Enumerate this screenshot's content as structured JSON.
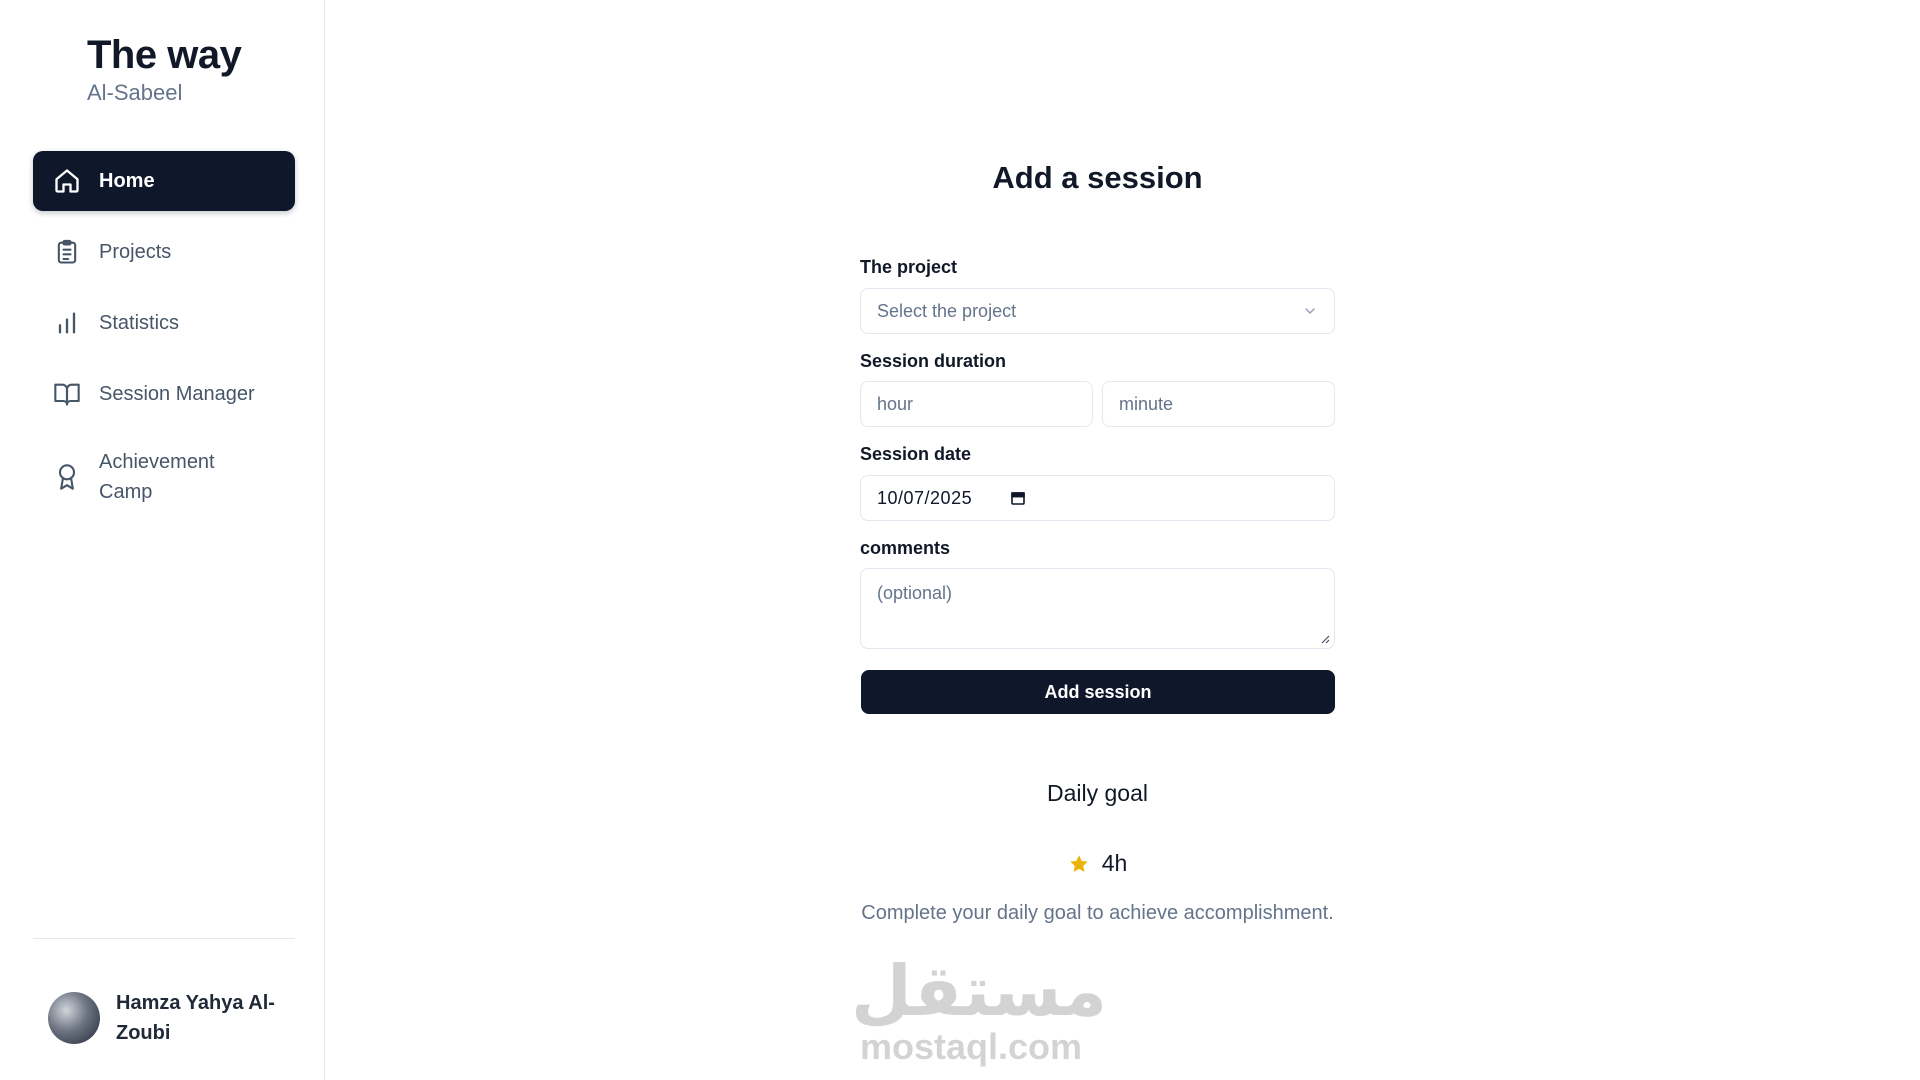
{
  "brand": {
    "title": "The way",
    "subtitle": "Al-Sabeel"
  },
  "nav": [
    {
      "label": "Home",
      "icon": "home-icon",
      "active": true
    },
    {
      "label": "Projects",
      "icon": "clipboard-icon",
      "active": false
    },
    {
      "label": "Statistics",
      "icon": "bar-chart-icon",
      "active": false
    },
    {
      "label": "Session Manager",
      "icon": "book-open-icon",
      "active": false
    },
    {
      "label": "Achievement Camp",
      "icon": "award-icon",
      "active": false
    }
  ],
  "user": {
    "name": "Hamza Yahya Al-Zoubi"
  },
  "form": {
    "title": "Add a session",
    "project_label": "The project",
    "project_placeholder": "Select the project",
    "duration_label": "Session duration",
    "hour_placeholder": "hour",
    "minute_placeholder": "minute",
    "date_label": "Session date",
    "date_value": "10/07/2025",
    "comments_label": "comments",
    "comments_placeholder": "(optional)",
    "submit_label": "Add session"
  },
  "goal": {
    "title": "Daily goal",
    "value": "4h",
    "description": "Complete your daily goal to achieve accomplishment."
  },
  "watermark": {
    "arabic": "مستقل",
    "latin": "mostaql.com"
  },
  "colors": {
    "primary": "#0f172a",
    "muted": "#64748b",
    "star": "#eab308",
    "border": "#e2e8f0"
  }
}
